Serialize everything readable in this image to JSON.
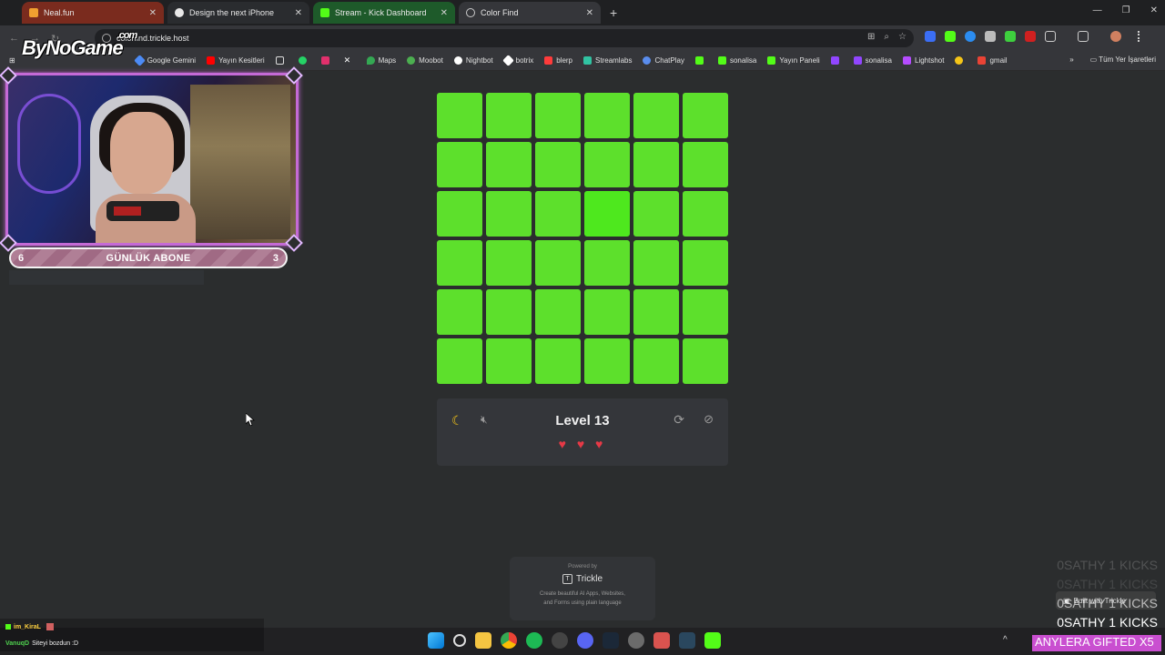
{
  "browser": {
    "tabs": [
      {
        "label": "Neal.fun",
        "color": "#7a2b1e",
        "favicon": "#f0a030"
      },
      {
        "label": "Design the next iPhone",
        "color": "#2a2c2f",
        "favicon": "#ffffff"
      },
      {
        "label": "Stream - Kick Dashboard",
        "color": "#1e5a2a",
        "favicon": "#53fc18"
      },
      {
        "label": "Color Find",
        "color": "#35363a",
        "favicon": "#cccccc"
      }
    ],
    "url": "colorfind.trickle.host",
    "bookmarks": [
      {
        "label": "Google Gemini",
        "color": "#4c8bf5"
      },
      {
        "label": "Yayın Kesitleri",
        "color": "#ff0000"
      },
      {
        "label": "",
        "color": "#d0d0d0"
      },
      {
        "label": "",
        "color": "#25d366"
      },
      {
        "label": "",
        "color": "#e1306c"
      },
      {
        "label": "",
        "color": "#ffffff"
      },
      {
        "label": "Maps",
        "color": "#34a853"
      },
      {
        "label": "Moobot",
        "color": "#4caf50"
      },
      {
        "label": "Nightbot",
        "color": "#ffffff"
      },
      {
        "label": "botrix",
        "color": "#ffffff"
      },
      {
        "label": "blerp",
        "color": "#ff3b3b"
      },
      {
        "label": "Streamlabs",
        "color": "#31c3a2"
      },
      {
        "label": "ChatPlay",
        "color": "#5a8dee"
      },
      {
        "label": "",
        "color": "#53fc18"
      },
      {
        "label": "sonalisa",
        "color": "#53fc18"
      },
      {
        "label": "Yayın Paneli",
        "color": "#53fc18"
      },
      {
        "label": "",
        "color": "#9146ff"
      },
      {
        "label": "sonalisa",
        "color": "#9146ff"
      },
      {
        "label": "Lightshot",
        "color": "#b54cff"
      },
      {
        "label": "",
        "color": "#f5c518"
      },
      {
        "label": "gmail",
        "color": "#ea4335"
      }
    ],
    "bookmarks_right": "Tüm Yer İşaretleri"
  },
  "overlay": {
    "logo": "ByNoGame",
    "logo_suffix": ".com",
    "abone_left": "6",
    "abone_title": "GÜNLÜK ABONE",
    "abone_right": "3",
    "kicks": [
      "0SATHY 1 KICKS",
      "0SATHY 1 KICKS",
      "0SATHY 1 KICKS",
      "0SATHY 1 KICKS"
    ],
    "built_with": "Built with Trickle",
    "gifted": "ANYLERA GIFTED X5",
    "chat": [
      {
        "user": "im_KiraL",
        "message": ""
      },
      {
        "user": "VanuqD",
        "message": "Siteyi bozdun :D"
      }
    ]
  },
  "game": {
    "base_color": "#5de02c",
    "odd_color": "#4ee81e",
    "odd_index": 15,
    "rows": 6,
    "cols": 6,
    "level_text": "Level 13",
    "lives": 3,
    "hearts": "♥ ♥ ♥",
    "icons": [
      "moon-icon",
      "speaker-mute-icon",
      "refresh-icon",
      "eye-off-icon"
    ]
  },
  "powered": {
    "line1": "Powered by",
    "brand": "Trickle",
    "line3": "Create beautiful AI Apps, Websites,",
    "line4": "and Forms using plain language"
  }
}
